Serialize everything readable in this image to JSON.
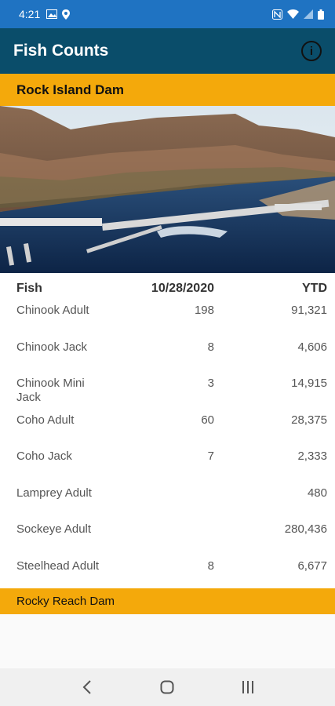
{
  "status_bar": {
    "time": "4:21"
  },
  "app_bar": {
    "title": "Fish Counts",
    "info_label": "i"
  },
  "sections": {
    "primary": "Rock Island Dam",
    "secondary": "Rocky Reach Dam"
  },
  "table": {
    "headers": {
      "fish": "Fish",
      "day": "10/28/2020",
      "ytd": "YTD"
    },
    "rows": [
      {
        "fish": "Chinook Adult",
        "day": "198",
        "ytd": "91,321"
      },
      {
        "fish": "Chinook Jack",
        "day": "8",
        "ytd": "4,606"
      },
      {
        "fish": "Chinook Mini Jack",
        "day": "3",
        "ytd": "14,915"
      },
      {
        "fish": "Coho Adult",
        "day": "60",
        "ytd": "28,375"
      },
      {
        "fish": "Coho Jack",
        "day": "7",
        "ytd": "2,333"
      },
      {
        "fish": "Lamprey Adult",
        "day": "",
        "ytd": "480"
      },
      {
        "fish": "Sockeye Adult",
        "day": "",
        "ytd": "280,436"
      },
      {
        "fish": "Steelhead Adult",
        "day": "8",
        "ytd": "6,677"
      }
    ]
  },
  "colors": {
    "status_bar": "#1f73c2",
    "app_bar": "#0a4d6a",
    "accent": "#f4a90b"
  },
  "icons": [
    "image-icon",
    "location-icon",
    "nfc-icon",
    "wifi-icon",
    "signal-icon",
    "battery-icon",
    "info-icon",
    "back-icon",
    "home-icon",
    "recents-icon"
  ]
}
